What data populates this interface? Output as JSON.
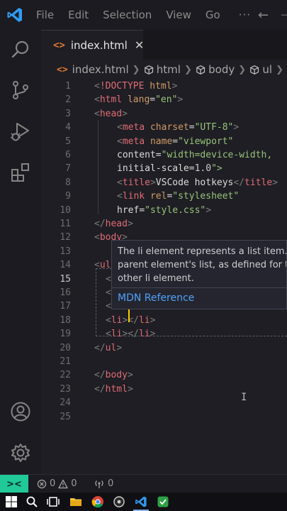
{
  "menu": [
    "File",
    "Edit",
    "Selection",
    "View",
    "Go"
  ],
  "menu_more": "···",
  "tab": {
    "label": "index.html",
    "icon": "<>",
    "close": "✕"
  },
  "breadcrumb": [
    "index.html",
    "html",
    "body",
    "ul"
  ],
  "code": {
    "line_numbers": [
      "1",
      "2",
      "3",
      "4",
      "5",
      "6",
      "7",
      "8",
      "9",
      "10",
      "11",
      "12",
      "13",
      "14",
      "15",
      "16",
      "17",
      "18",
      "19",
      "20",
      "21",
      "22",
      "23",
      "24",
      "25"
    ],
    "lines": [
      "<!DOCTYPE html>",
      "<html lang=\"en\">",
      "<head>",
      "<meta charset=\"UTF-8\">",
      "<meta name=\"viewport\"",
      "content=\"width=device-width,",
      "initial-scale=1.0\">",
      "<title>VSCode hotkeys</title>",
      "<link rel=\"stylesheet\"",
      "href=\"style.css\">",
      "</head>",
      "<body>",
      "",
      "<ul",
      "<",
      "<",
      "<",
      "<li></li>",
      "<li></li>",
      "</ul>",
      "",
      "</body>",
      "</html>",
      "",
      ""
    ]
  },
  "hover": {
    "text_lines": [
      "The li element represents a list item. If",
      "parent element's list, as defined for th",
      "other li element."
    ],
    "link": "MDN Reference"
  },
  "status": {
    "remote_icon": "><",
    "errors": "0",
    "warnings": "0",
    "ports": "0"
  },
  "colors": {
    "accent": "#20c997",
    "tag": "#e06c75",
    "attr": "#d19a66",
    "string": "#98c379",
    "link": "#4fa3f7",
    "cursor": "#ffcc00"
  }
}
